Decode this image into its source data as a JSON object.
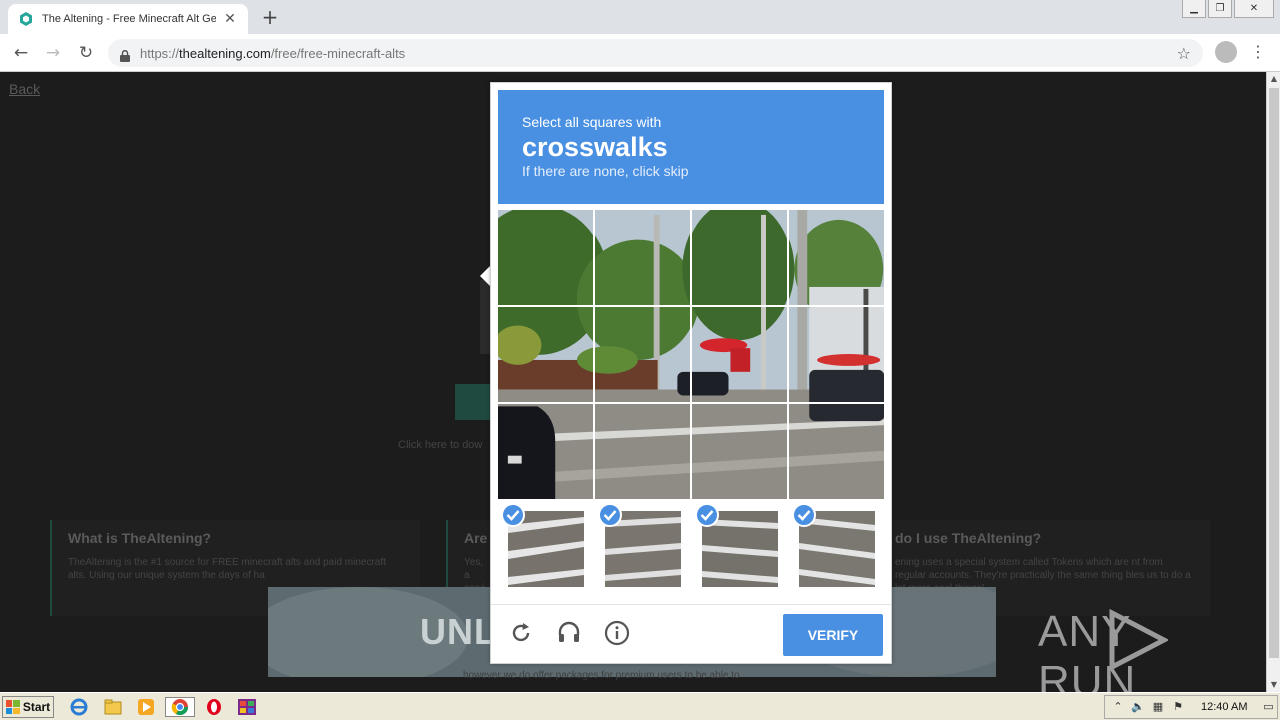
{
  "browser": {
    "tab_title": "The Altening - Free Minecraft Alt Gen",
    "url_scheme": "https://",
    "url_host": "thealtening.com",
    "url_path": "/free/free-minecraft-alts"
  },
  "page": {
    "back_label": "Back",
    "download_text": "Click here to dow",
    "cards": [
      {
        "title": "What is TheAltening?",
        "text": "TheAltening is the #1 source for FREE minecraft alts and paid minecraft alts. Using our unique system the days of ha"
      },
      {
        "title": "Are",
        "text": "Yes, a servi"
      },
      {
        "title": "do I use TheAltening?",
        "text": "ening uses a special system called Tokens which are nt from regular accounts. They're practically the same thing bles us to do a lot more cool things!..."
      }
    ],
    "banner_text": "UNL",
    "bottom_text": "however we do offer packages for premium users to be able to"
  },
  "captcha": {
    "line1": "Select all squares with",
    "object": "crosswalks",
    "line3": "If there are none, click skip",
    "selected_count": 4,
    "verify_label": "VERIFY",
    "icons": [
      "reload-icon",
      "audio-icon",
      "info-icon"
    ]
  },
  "watermark": {
    "left": "ANY",
    "right": "RUN"
  },
  "taskbar": {
    "start_label": "Start",
    "clock": "12:40 AM"
  }
}
